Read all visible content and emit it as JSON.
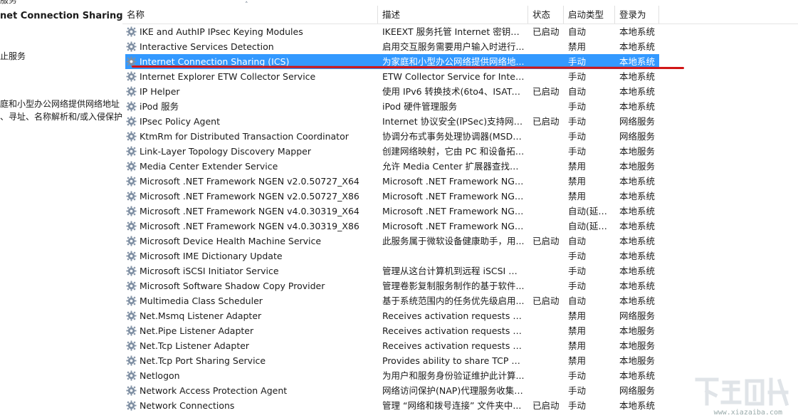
{
  "left_pane": {
    "top_cut_text": "服务",
    "title": "net Connection Sharing",
    "lines": [
      "止服务",
      "庭和小型办公网络提供网络地址",
      "、寻址、名称解析和/或入侵保护"
    ]
  },
  "columns": {
    "name": "名称",
    "description": "描述",
    "status": "状态",
    "startup_type": "启动类型",
    "log_on_as": "登录为"
  },
  "selected_row_index": 2,
  "services": [
    {
      "name": "IKE and AuthIP IPsec Keying Modules",
      "description": "IKEEXT 服务托管 Internet 密钥交...",
      "status": "已启动",
      "startup_type": "自动",
      "log_on_as": "本地系统"
    },
    {
      "name": "Interactive Services Detection",
      "description": "启用交互服务需要用户输入时进行...",
      "status": "",
      "startup_type": "禁用",
      "log_on_as": "本地系统"
    },
    {
      "name": "Internet Connection Sharing (ICS)",
      "description": "为家庭和小型办公网络提供网络地...",
      "status": "",
      "startup_type": "手动",
      "log_on_as": "本地系统"
    },
    {
      "name": "Internet Explorer ETW Collector Service",
      "description": "ETW Collector Service for Intern...",
      "status": "",
      "startup_type": "手动",
      "log_on_as": "本地系统"
    },
    {
      "name": "IP Helper",
      "description": "使用 IPv6 转换技术(6to4、ISATAP...",
      "status": "已启动",
      "startup_type": "自动",
      "log_on_as": "本地系统"
    },
    {
      "name": "iPod 服务",
      "description": "iPod 硬件管理服务",
      "status": "",
      "startup_type": "手动",
      "log_on_as": "本地系统"
    },
    {
      "name": "IPsec Policy Agent",
      "description": "Internet 协议安全(IPSec)支持网络...",
      "status": "已启动",
      "startup_type": "手动",
      "log_on_as": "网络服务"
    },
    {
      "name": "KtmRm for Distributed Transaction Coordinator",
      "description": "协调分布式事务处理协调器(MSDTC...",
      "status": "",
      "startup_type": "手动",
      "log_on_as": "网络服务"
    },
    {
      "name": "Link-Layer Topology Discovery Mapper",
      "description": "创建网络映射，它由 PC 和设备拓扑...",
      "status": "",
      "startup_type": "手动",
      "log_on_as": "本地服务"
    },
    {
      "name": "Media Center Extender Service",
      "description": "允许 Media Center 扩展器查找并...",
      "status": "",
      "startup_type": "禁用",
      "log_on_as": "本地服务"
    },
    {
      "name": "Microsoft .NET Framework NGEN v2.0.50727_X64",
      "description": "Microsoft .NET Framework NGEN",
      "status": "",
      "startup_type": "禁用",
      "log_on_as": "本地系统"
    },
    {
      "name": "Microsoft .NET Framework NGEN v2.0.50727_X86",
      "description": "Microsoft .NET Framework NGEN",
      "status": "",
      "startup_type": "禁用",
      "log_on_as": "本地系统"
    },
    {
      "name": "Microsoft .NET Framework NGEN v4.0.30319_X64",
      "description": "Microsoft .NET Framework NGEN",
      "status": "",
      "startup_type": "自动(延迟...",
      "log_on_as": "本地系统"
    },
    {
      "name": "Microsoft .NET Framework NGEN v4.0.30319_X86",
      "description": "Microsoft .NET Framework NGEN",
      "status": "",
      "startup_type": "自动(延迟...",
      "log_on_as": "本地系统"
    },
    {
      "name": "Microsoft Device Health Machine Service",
      "description": "此服务属于微软设备健康助手，用...",
      "status": "已启动",
      "startup_type": "自动",
      "log_on_as": "本地系统"
    },
    {
      "name": "Microsoft IME Dictionary Update",
      "description": "",
      "status": "",
      "startup_type": "手动",
      "log_on_as": "本地系统"
    },
    {
      "name": "Microsoft iSCSI Initiator Service",
      "description": "管理从这台计算机到远程 iSCSI 目...",
      "status": "",
      "startup_type": "手动",
      "log_on_as": "本地系统"
    },
    {
      "name": "Microsoft Software Shadow Copy Provider",
      "description": "管理卷影复制服务制作的基于软件...",
      "status": "",
      "startup_type": "手动",
      "log_on_as": "本地系统"
    },
    {
      "name": "Multimedia Class Scheduler",
      "description": "基于系统范围内的任务优先级启用...",
      "status": "已启动",
      "startup_type": "自动",
      "log_on_as": "本地系统"
    },
    {
      "name": "Net.Msmq Listener Adapter",
      "description": "Receives activation requests ove...",
      "status": "",
      "startup_type": "禁用",
      "log_on_as": "网络服务"
    },
    {
      "name": "Net.Pipe Listener Adapter",
      "description": "Receives activation requests ove...",
      "status": "",
      "startup_type": "禁用",
      "log_on_as": "本地服务"
    },
    {
      "name": "Net.Tcp Listener Adapter",
      "description": "Receives activation requests ove...",
      "status": "",
      "startup_type": "禁用",
      "log_on_as": "本地服务"
    },
    {
      "name": "Net.Tcp Port Sharing Service",
      "description": "Provides ability to share TCP por...",
      "status": "",
      "startup_type": "禁用",
      "log_on_as": "本地服务"
    },
    {
      "name": "Netlogon",
      "description": "为用户和服务身份验证维护此计算...",
      "status": "",
      "startup_type": "手动",
      "log_on_as": "本地系统"
    },
    {
      "name": "Network Access Protection Agent",
      "description": "网络访问保护(NAP)代理服务收集和...",
      "status": "",
      "startup_type": "手动",
      "log_on_as": "网络服务"
    },
    {
      "name": "Network Connections",
      "description": "管理 “网络和拨号连接” 文件夹中...",
      "status": "已启动",
      "startup_type": "手动",
      "log_on_as": "本地系统"
    }
  ],
  "watermark": {
    "url_text": "www.xiazaiba.com"
  },
  "colors": {
    "selection": "#3399ff",
    "annotation_underline": "#d11414",
    "gear_icon": "#7f8fa3"
  }
}
